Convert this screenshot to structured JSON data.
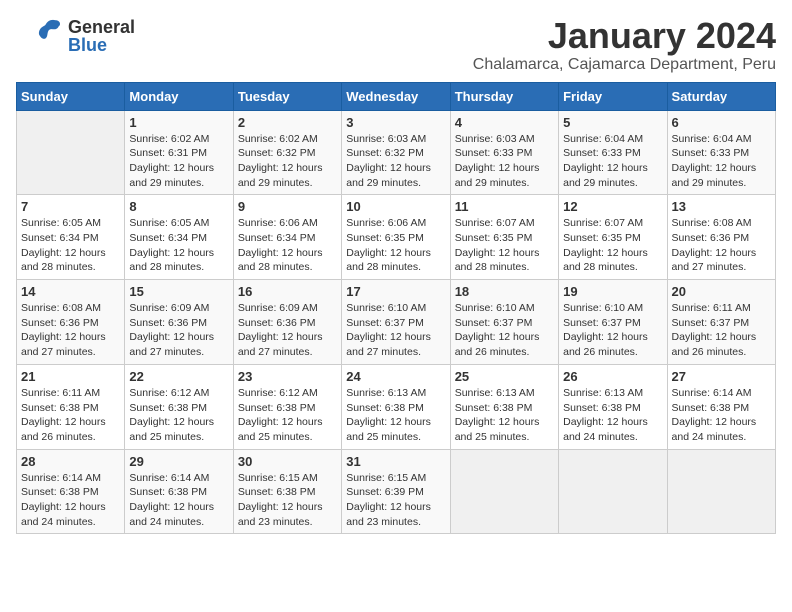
{
  "header": {
    "logo_general": "General",
    "logo_blue": "Blue",
    "title": "January 2024",
    "subtitle": "Chalamarca, Cajamarca Department, Peru"
  },
  "days_of_week": [
    "Sunday",
    "Monday",
    "Tuesday",
    "Wednesday",
    "Thursday",
    "Friday",
    "Saturday"
  ],
  "weeks": [
    [
      {
        "num": "",
        "info": ""
      },
      {
        "num": "1",
        "info": "Sunrise: 6:02 AM\nSunset: 6:31 PM\nDaylight: 12 hours\nand 29 minutes."
      },
      {
        "num": "2",
        "info": "Sunrise: 6:02 AM\nSunset: 6:32 PM\nDaylight: 12 hours\nand 29 minutes."
      },
      {
        "num": "3",
        "info": "Sunrise: 6:03 AM\nSunset: 6:32 PM\nDaylight: 12 hours\nand 29 minutes."
      },
      {
        "num": "4",
        "info": "Sunrise: 6:03 AM\nSunset: 6:33 PM\nDaylight: 12 hours\nand 29 minutes."
      },
      {
        "num": "5",
        "info": "Sunrise: 6:04 AM\nSunset: 6:33 PM\nDaylight: 12 hours\nand 29 minutes."
      },
      {
        "num": "6",
        "info": "Sunrise: 6:04 AM\nSunset: 6:33 PM\nDaylight: 12 hours\nand 29 minutes."
      }
    ],
    [
      {
        "num": "7",
        "info": "Sunrise: 6:05 AM\nSunset: 6:34 PM\nDaylight: 12 hours\nand 28 minutes."
      },
      {
        "num": "8",
        "info": "Sunrise: 6:05 AM\nSunset: 6:34 PM\nDaylight: 12 hours\nand 28 minutes."
      },
      {
        "num": "9",
        "info": "Sunrise: 6:06 AM\nSunset: 6:34 PM\nDaylight: 12 hours\nand 28 minutes."
      },
      {
        "num": "10",
        "info": "Sunrise: 6:06 AM\nSunset: 6:35 PM\nDaylight: 12 hours\nand 28 minutes."
      },
      {
        "num": "11",
        "info": "Sunrise: 6:07 AM\nSunset: 6:35 PM\nDaylight: 12 hours\nand 28 minutes."
      },
      {
        "num": "12",
        "info": "Sunrise: 6:07 AM\nSunset: 6:35 PM\nDaylight: 12 hours\nand 28 minutes."
      },
      {
        "num": "13",
        "info": "Sunrise: 6:08 AM\nSunset: 6:36 PM\nDaylight: 12 hours\nand 27 minutes."
      }
    ],
    [
      {
        "num": "14",
        "info": "Sunrise: 6:08 AM\nSunset: 6:36 PM\nDaylight: 12 hours\nand 27 minutes."
      },
      {
        "num": "15",
        "info": "Sunrise: 6:09 AM\nSunset: 6:36 PM\nDaylight: 12 hours\nand 27 minutes."
      },
      {
        "num": "16",
        "info": "Sunrise: 6:09 AM\nSunset: 6:36 PM\nDaylight: 12 hours\nand 27 minutes."
      },
      {
        "num": "17",
        "info": "Sunrise: 6:10 AM\nSunset: 6:37 PM\nDaylight: 12 hours\nand 27 minutes."
      },
      {
        "num": "18",
        "info": "Sunrise: 6:10 AM\nSunset: 6:37 PM\nDaylight: 12 hours\nand 26 minutes."
      },
      {
        "num": "19",
        "info": "Sunrise: 6:10 AM\nSunset: 6:37 PM\nDaylight: 12 hours\nand 26 minutes."
      },
      {
        "num": "20",
        "info": "Sunrise: 6:11 AM\nSunset: 6:37 PM\nDaylight: 12 hours\nand 26 minutes."
      }
    ],
    [
      {
        "num": "21",
        "info": "Sunrise: 6:11 AM\nSunset: 6:38 PM\nDaylight: 12 hours\nand 26 minutes."
      },
      {
        "num": "22",
        "info": "Sunrise: 6:12 AM\nSunset: 6:38 PM\nDaylight: 12 hours\nand 25 minutes."
      },
      {
        "num": "23",
        "info": "Sunrise: 6:12 AM\nSunset: 6:38 PM\nDaylight: 12 hours\nand 25 minutes."
      },
      {
        "num": "24",
        "info": "Sunrise: 6:13 AM\nSunset: 6:38 PM\nDaylight: 12 hours\nand 25 minutes."
      },
      {
        "num": "25",
        "info": "Sunrise: 6:13 AM\nSunset: 6:38 PM\nDaylight: 12 hours\nand 25 minutes."
      },
      {
        "num": "26",
        "info": "Sunrise: 6:13 AM\nSunset: 6:38 PM\nDaylight: 12 hours\nand 24 minutes."
      },
      {
        "num": "27",
        "info": "Sunrise: 6:14 AM\nSunset: 6:38 PM\nDaylight: 12 hours\nand 24 minutes."
      }
    ],
    [
      {
        "num": "28",
        "info": "Sunrise: 6:14 AM\nSunset: 6:38 PM\nDaylight: 12 hours\nand 24 minutes."
      },
      {
        "num": "29",
        "info": "Sunrise: 6:14 AM\nSunset: 6:38 PM\nDaylight: 12 hours\nand 24 minutes."
      },
      {
        "num": "30",
        "info": "Sunrise: 6:15 AM\nSunset: 6:38 PM\nDaylight: 12 hours\nand 23 minutes."
      },
      {
        "num": "31",
        "info": "Sunrise: 6:15 AM\nSunset: 6:39 PM\nDaylight: 12 hours\nand 23 minutes."
      },
      {
        "num": "",
        "info": ""
      },
      {
        "num": "",
        "info": ""
      },
      {
        "num": "",
        "info": ""
      }
    ]
  ]
}
